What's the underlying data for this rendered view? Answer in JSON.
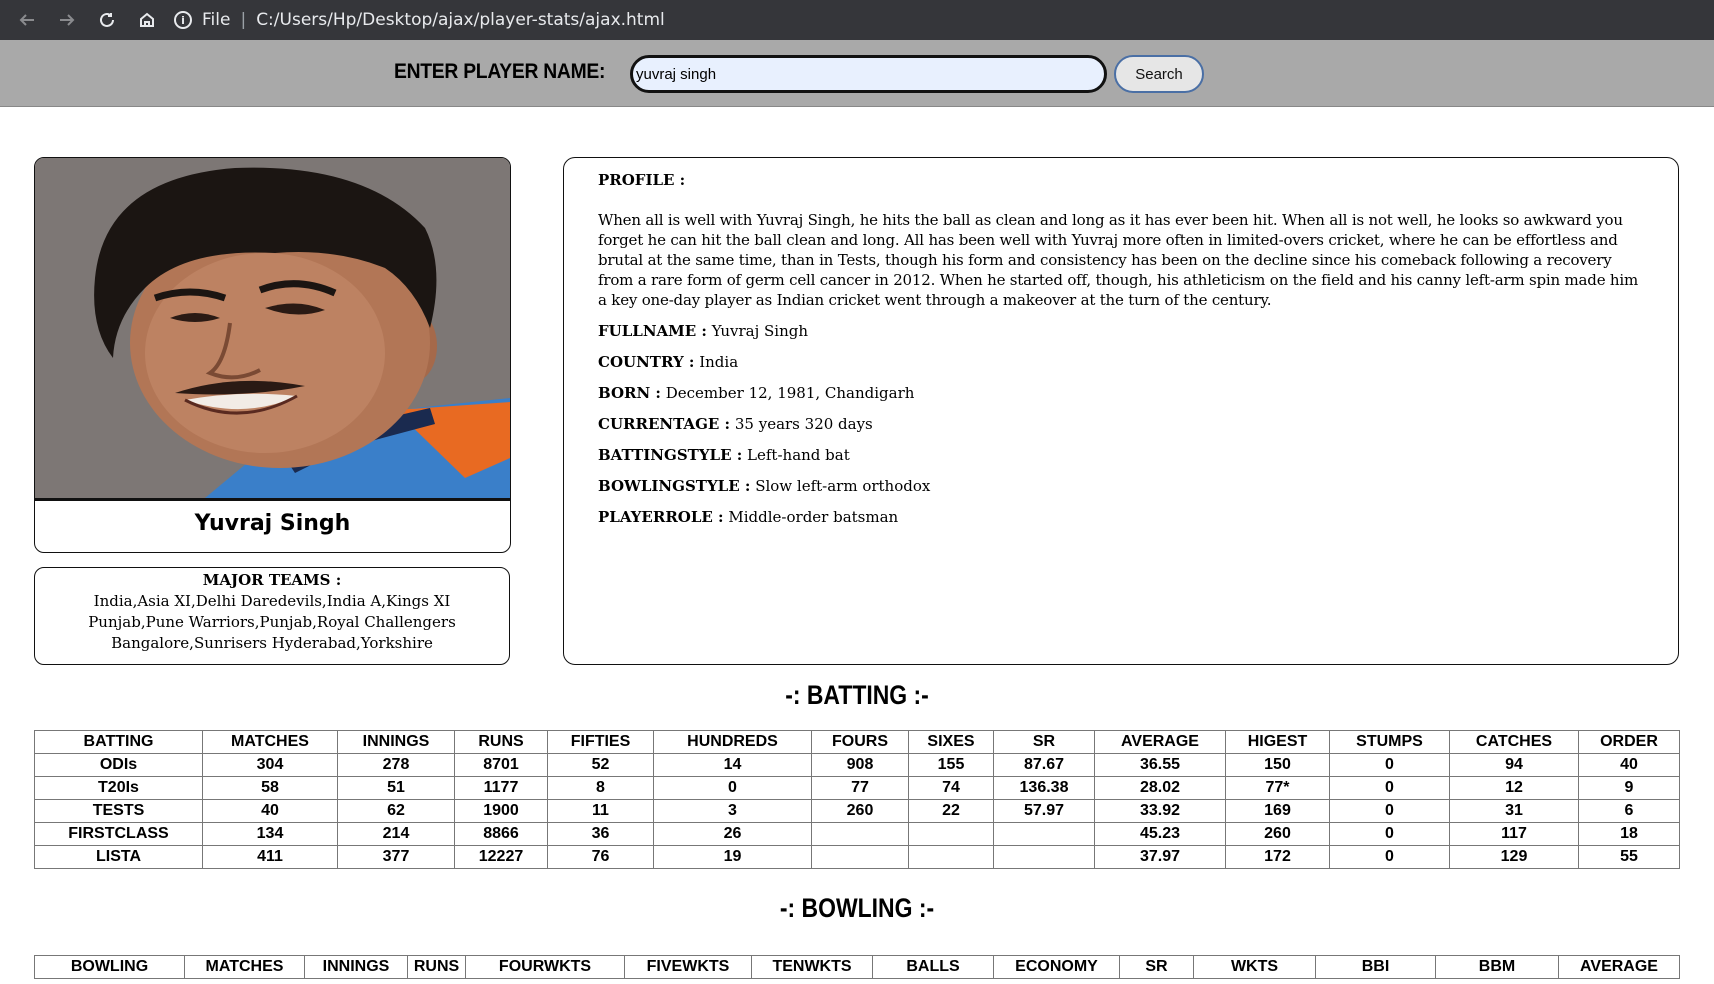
{
  "browser": {
    "file_label": "File",
    "url": "C:/Users/Hp/Desktop/ajax/player-stats/ajax.html"
  },
  "search": {
    "label": "ENTER PLAYER NAME:",
    "value": "yuvraj singh",
    "button_label": "Search"
  },
  "player": {
    "name": "Yuvraj Singh",
    "teams_label": "MAJOR TEAMS :",
    "teams": "India,Asia XI,Delhi Daredevils,India A,Kings XI Punjab,Pune Warriors,Punjab,Royal Challengers Bangalore,Sunrisers Hyderabad,Yorkshire"
  },
  "profile": {
    "header": "PROFILE :",
    "bio": "When all is well with Yuvraj Singh, he hits the ball as clean and long as it has ever been hit. When all is not well, he looks so awkward you forget he can hit the ball clean and long. All has been well with Yuvraj more often in limited-overs cricket, where he can be effortless and brutal at the same time, than in Tests, though his form and consistency has been on the decline since his comeback following a recovery from a rare form of germ cell cancer in 2012. When he started off, though, his athleticism on the field and his canny left-arm spin made him a key one-day player as Indian cricket went through a makeover at the turn of the century.",
    "fields": [
      {
        "label": "FULLNAME :",
        "value": "Yuvraj Singh"
      },
      {
        "label": "COUNTRY :",
        "value": "India"
      },
      {
        "label": "BORN :",
        "value": "December 12, 1981, Chandigarh"
      },
      {
        "label": "CURRENTAGE :",
        "value": "35 years 320 days"
      },
      {
        "label": "BATTINGSTYLE :",
        "value": "Left-hand bat"
      },
      {
        "label": "BOWLINGSTYLE :",
        "value": "Slow left-arm orthodox"
      },
      {
        "label": "PLAYERROLE :",
        "value": "Middle-order batsman"
      }
    ]
  },
  "batting": {
    "title": "-: BATTING :-",
    "headers": [
      "BATTING",
      "MATCHES",
      "INNINGS",
      "RUNS",
      "FIFTIES",
      "HUNDREDS",
      "FOURS",
      "SIXES",
      "SR",
      "AVERAGE",
      "HIGEST",
      "STUMPS",
      "CATCHES",
      "ORDER"
    ],
    "rows": [
      [
        "ODIs",
        "304",
        "278",
        "8701",
        "52",
        "14",
        "908",
        "155",
        "87.67",
        "36.55",
        "150",
        "0",
        "94",
        "40"
      ],
      [
        "T20Is",
        "58",
        "51",
        "1177",
        "8",
        "0",
        "77",
        "74",
        "136.38",
        "28.02",
        "77*",
        "0",
        "12",
        "9"
      ],
      [
        "TESTS",
        "40",
        "62",
        "1900",
        "11",
        "3",
        "260",
        "22",
        "57.97",
        "33.92",
        "169",
        "0",
        "31",
        "6"
      ],
      [
        "FIRSTCLASS",
        "134",
        "214",
        "8866",
        "36",
        "26",
        "",
        "",
        "",
        "45.23",
        "260",
        "0",
        "117",
        "18"
      ],
      [
        "LISTA",
        "411",
        "377",
        "12227",
        "76",
        "19",
        "",
        "",
        "",
        "37.97",
        "172",
        "0",
        "129",
        "55"
      ]
    ]
  },
  "bowling": {
    "title": "-: BOWLING :-",
    "headers": [
      "BOWLING",
      "MATCHES",
      "INNINGS",
      "RUNS",
      "FOURWKTS",
      "FIVEWKTS",
      "TENWKTS",
      "BALLS",
      "ECONOMY",
      "SR",
      "WKTS",
      "BBI",
      "BBM",
      "AVERAGE"
    ]
  }
}
